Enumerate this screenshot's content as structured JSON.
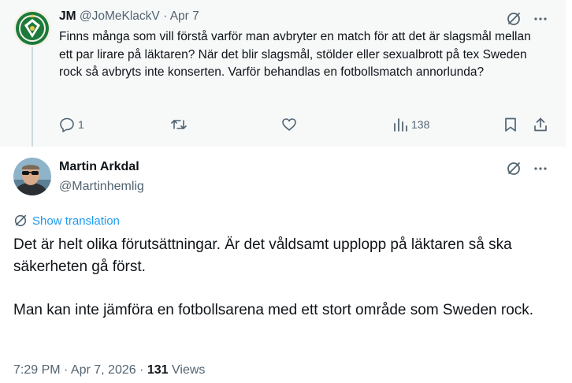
{
  "parent_tweet": {
    "author_name": "JM",
    "author_handle": "@JoMeKlackV",
    "separator": "·",
    "date": "Apr 7",
    "text": "Finns många som vill förstå varför man avbryter en match för att det är slagsmål mellan ett par lirare på läktaren? När det blir slagsmål, stölder eller sexualbrott på tex Sweden rock så avbryts inte konserten. Varför behandlas en fotbollsmatch annorlunda?",
    "actions": {
      "reply_count": "1",
      "retweet_count": "",
      "like_count": "",
      "views_count": "138"
    },
    "icons": {
      "grok": "grok-icon",
      "more": "more-icon",
      "reply": "reply-icon",
      "retweet": "retweet-icon",
      "like": "heart-icon",
      "views": "views-icon",
      "bookmark": "bookmark-icon",
      "share": "share-icon"
    }
  },
  "reply_tweet": {
    "author_name": "Martin Arkdal",
    "author_handle": "@Martinhemlig",
    "show_translation": "Show translation",
    "paragraphs": [
      "Det är helt olika förutsättningar. Är det våldsamt upplopp på läktaren så ska säkerheten gå först.",
      "Man kan inte jämföra en fotbollsarena med ett stort område som Sweden rock."
    ],
    "timestamp": "7:29 PM · Apr 7, 2026 · ",
    "views_count": "131",
    "views_label": " Views"
  },
  "colors": {
    "text_primary": "#0f1419",
    "text_secondary": "#536471",
    "link_blue": "#1d9bf0",
    "parent_bg": "#f7f9f9",
    "thread_line": "#cfd9de",
    "club_green": "#1b7a3a"
  }
}
